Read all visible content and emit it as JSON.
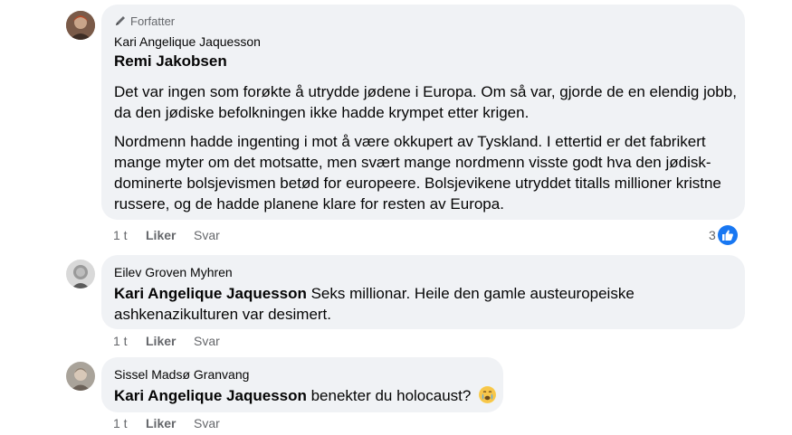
{
  "comments": [
    {
      "badge": "Forfatter",
      "name": "Kari Angelique Jaquesson",
      "reply_to": "Remi Jakobsen",
      "paragraphs": [
        "Det var ingen som forøkte å utrydde jødene i Europa. Om så var, gjorde de en elendig jobb, da den jødiske befolkningen ikke hadde krympet etter krigen.",
        "Nordmenn hadde ingenting i mot å være okkupert av Tyskland. I ettertid er det fabrikert mange myter om det motsatte, men svært mange nordmenn visste godt hva den jødisk-dominerte bolsjevismen betød for europeere. Bolsjevikene utryddet titalls millioner kristne russere, og de hadde planene klare for resten av Europa."
      ],
      "time": "1 t",
      "like_label": "Liker",
      "reply_label": "Svar",
      "reaction_count": "3",
      "reaction_icon": "thumbs-up-icon"
    },
    {
      "name": "Eilev Groven Myhren",
      "mention": "Kari Angelique Jaquesson",
      "text": " Seks millionar. Heile den gamle austeuropeiske ashkenazikulturen var desimert.",
      "time": "1 t",
      "like_label": "Liker",
      "reply_label": "Svar"
    },
    {
      "name": "Sissel Madsø Granvang",
      "mention": "Kari Angelique Jaquesson",
      "text": " benekter du holocaust?",
      "emoji": "crying-face-icon",
      "time": "1 t",
      "like_label": "Liker",
      "reply_label": "Svar"
    }
  ],
  "colors": {
    "bubble": "#f0f2f5",
    "secondary_text": "#65676b",
    "like_blue": "#1877f2"
  }
}
